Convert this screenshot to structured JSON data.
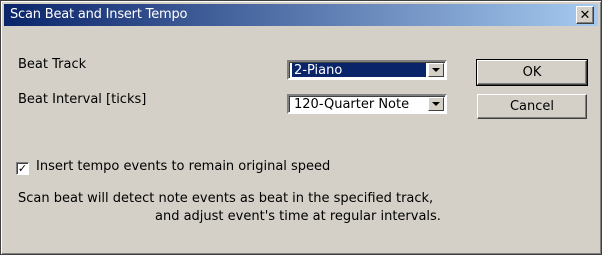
{
  "window": {
    "title": "Scan Beat and Insert Tempo",
    "close_glyph": "✕"
  },
  "fields": {
    "beat_track_label": "Beat Track",
    "beat_track_value": "2-Piano",
    "beat_interval_label": "Beat Interval [ticks]",
    "beat_interval_value": "120-Quarter Note"
  },
  "buttons": {
    "ok": "OK",
    "cancel": "Cancel"
  },
  "checkbox": {
    "label": "Insert tempo events to remain original speed",
    "checked": true,
    "glyph": "✓"
  },
  "description": {
    "line1": "Scan beat will detect note events as beat in the specified track,",
    "line2": "and adjust event's time at regular intervals."
  },
  "colors": {
    "title_bar": "#0a246a",
    "dialog_face": "#d4d0c8",
    "selection": "#0a246a"
  },
  "icons": {
    "close": "close-icon",
    "dropdown": "chevron-down-icon",
    "check": "checkmark-icon"
  }
}
